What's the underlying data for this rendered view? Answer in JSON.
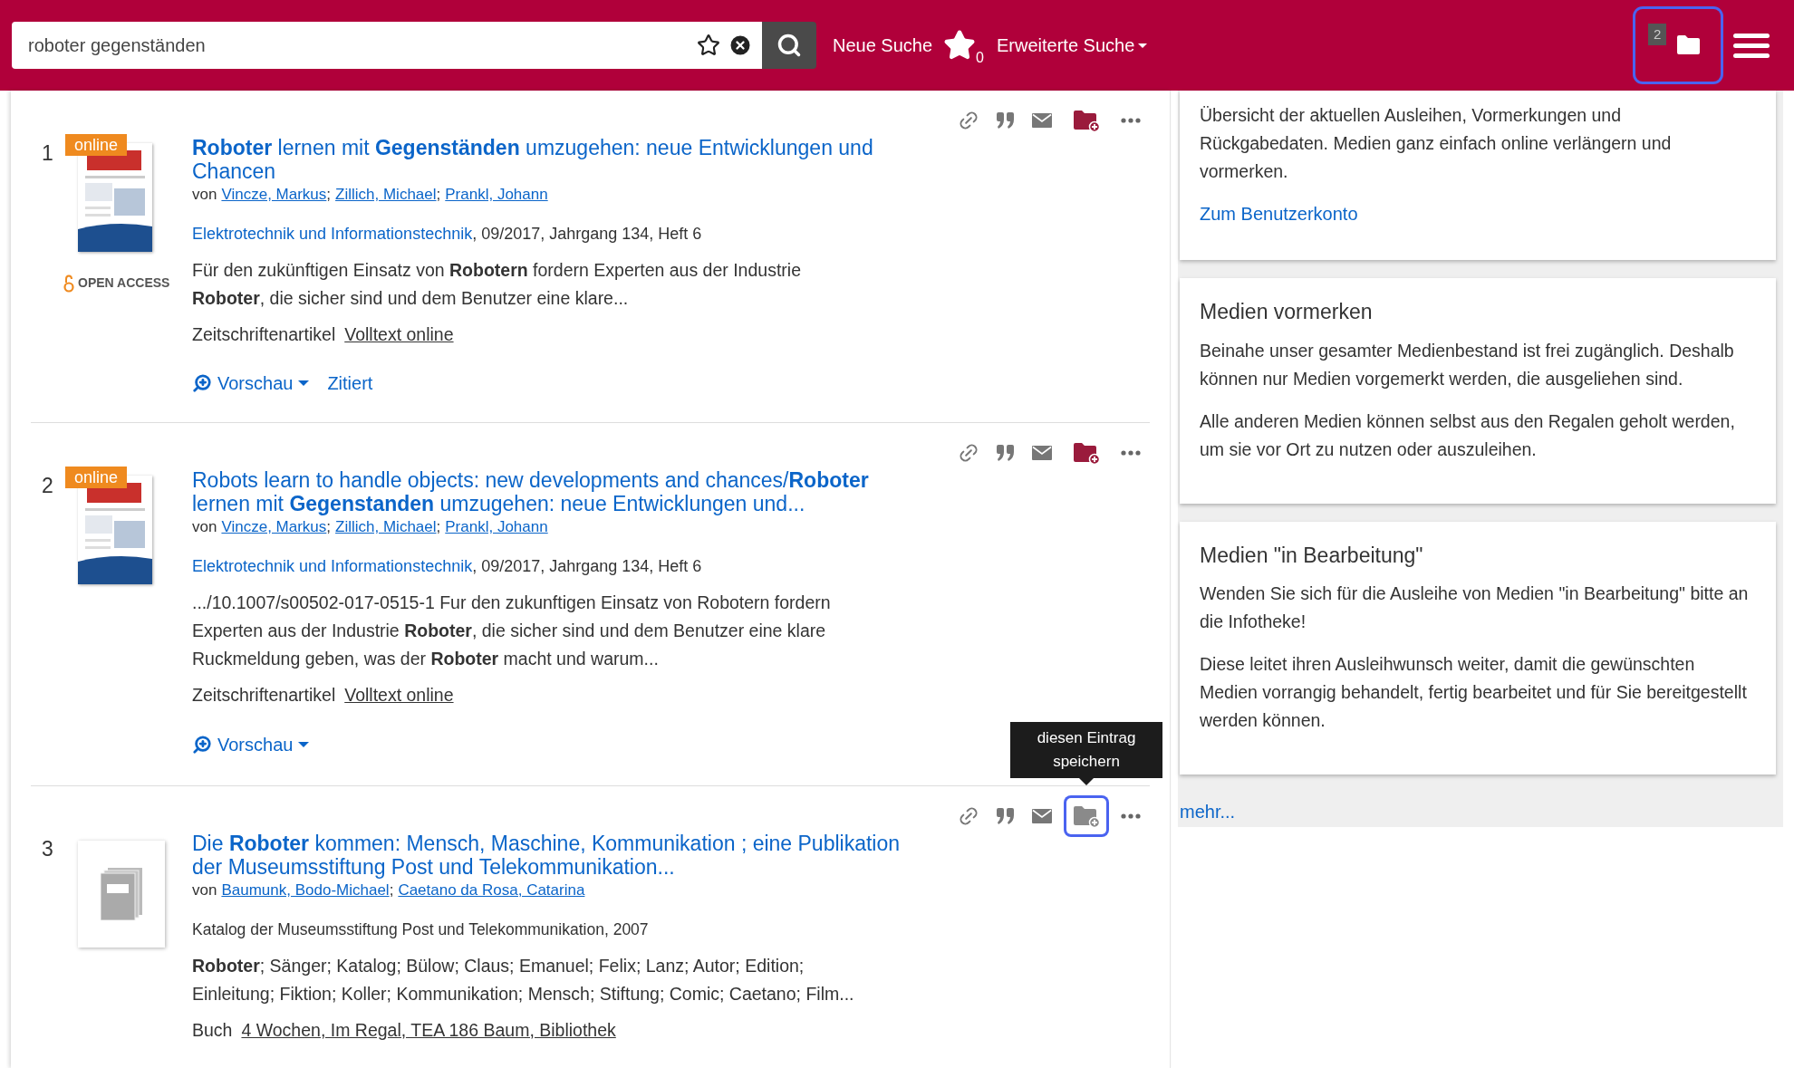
{
  "header": {
    "search": {
      "value": "roboter gegenständen"
    },
    "new_search": "Neue Suche",
    "favorites_count": "0",
    "advanced_search": "Erweiterte Suche",
    "folder": {
      "count": "2",
      "focused": true
    }
  },
  "results": [
    {
      "number": "1",
      "cover": {
        "kind": "journal",
        "badge": "online"
      },
      "open_access": "OPEN ACCESS",
      "title": "**Roboter** lernen mit **Gegenständen** umzugehen: neue Entwicklungen und Chancen",
      "authors_prefix": "von",
      "authors": [
        "Vincze, Markus",
        "Zillich, Michael",
        "Prankl, Johann"
      ],
      "separator": ";",
      "source": {
        "link": "Elektrotechnik und Informationstechnik",
        "text": ", 09/2017, Jahrgang 134, Heft 6"
      },
      "snippet": "Für den zukünftigen Einsatz von **Robotern** fordern Experten aus der Industrie **Roboter**, die sicher sind und dem Benutzer eine klare...",
      "type": "Zeitschriftenartikel",
      "availability": "Volltext online",
      "links": [
        {
          "kind": "preview",
          "label": "Vorschau"
        },
        {
          "kind": "cited",
          "label": "Zitiert"
        }
      ],
      "save_focused": false
    },
    {
      "number": "2",
      "cover": {
        "kind": "journal",
        "badge": "online"
      },
      "title": "Robots learn to handle objects: new developments and chances/**Roboter** lernen mit **Gegenstanden** umzugehen: neue Entwicklungen und...",
      "authors_prefix": "von",
      "authors": [
        "Vincze, Markus",
        "Zillich, Michael",
        "Prankl, Johann"
      ],
      "separator": ";",
      "source": {
        "link": "Elektrotechnik und Informationstechnik",
        "text": ", 09/2017, Jahrgang 134, Heft 6"
      },
      "snippet": ".../10.1007/s00502-017-0515-1 Fur den zukunftigen Einsatz von Robotern fordern Experten aus der Industrie **Roboter**, die sicher sind und dem Benutzer eine klare Ruckmeldung geben, was der **Roboter** macht und warum...",
      "type": "Zeitschriftenartikel",
      "availability": "Volltext online",
      "links": [
        {
          "kind": "preview",
          "label": "Vorschau"
        }
      ],
      "save_focused": false
    },
    {
      "number": "3",
      "cover": {
        "kind": "placeholder"
      },
      "title": "Die **Roboter** kommen: Mensch, Maschine, Kommunikation ; eine Publikation der Museumsstiftung Post und Telekommunikation...",
      "authors_prefix": "von",
      "authors": [
        "Baumunk, Bodo-Michael",
        "Caetano da Rosa, Catarina"
      ],
      "separator": ";",
      "source": {
        "text": "Katalog der Museumsstiftung Post und Telekommunikation, 2007"
      },
      "snippet": "**Roboter**; Sänger; Katalog; Bülow; Claus; Emanuel; Felix; Lanz; Autor; Edition; Einleitung; Fiktion; Koller; Kommunikation; Mensch; Stiftung; Comic; Caetano; Film...",
      "type": "Buch",
      "availability": "4 Wochen, Im Regal, TEA 186 Baum, Bibliothek",
      "save_focused": true,
      "save_tooltip": "diesen Eintrag speichern"
    }
  ],
  "sidebar": {
    "cards": [
      {
        "paragraphs": [
          "Übersicht der aktuellen Ausleihen, Vormerkungen und Rückgabedaten. Medien ganz einfach online verlängern und vormerken."
        ],
        "link": "Zum Benutzerkonto"
      },
      {
        "title": "Medien vormerken",
        "paragraphs": [
          "Beinahe unser gesamter Medienbestand ist frei zugänglich. Deshalb können nur Medien vorgemerkt werden, die ausgeliehen sind.",
          "Alle anderen Medien können selbst aus den Regalen geholt werden, um sie vor Ort zu nutzen oder auszuleihen."
        ]
      },
      {
        "title": "Medien \"in Bearbeitung\"",
        "paragraphs": [
          "Wenden Sie sich für die Ausleihe von Medien \"in Bearbeitung\" bitte an die Infotheke!",
          "Diese leitet ihren Ausleihwunsch weiter, damit die gewünschten Medien vorrangig behandelt, fertig bearbeitet und für Sie bereitgestellt werden können."
        ]
      }
    ],
    "more": "mehr..."
  }
}
